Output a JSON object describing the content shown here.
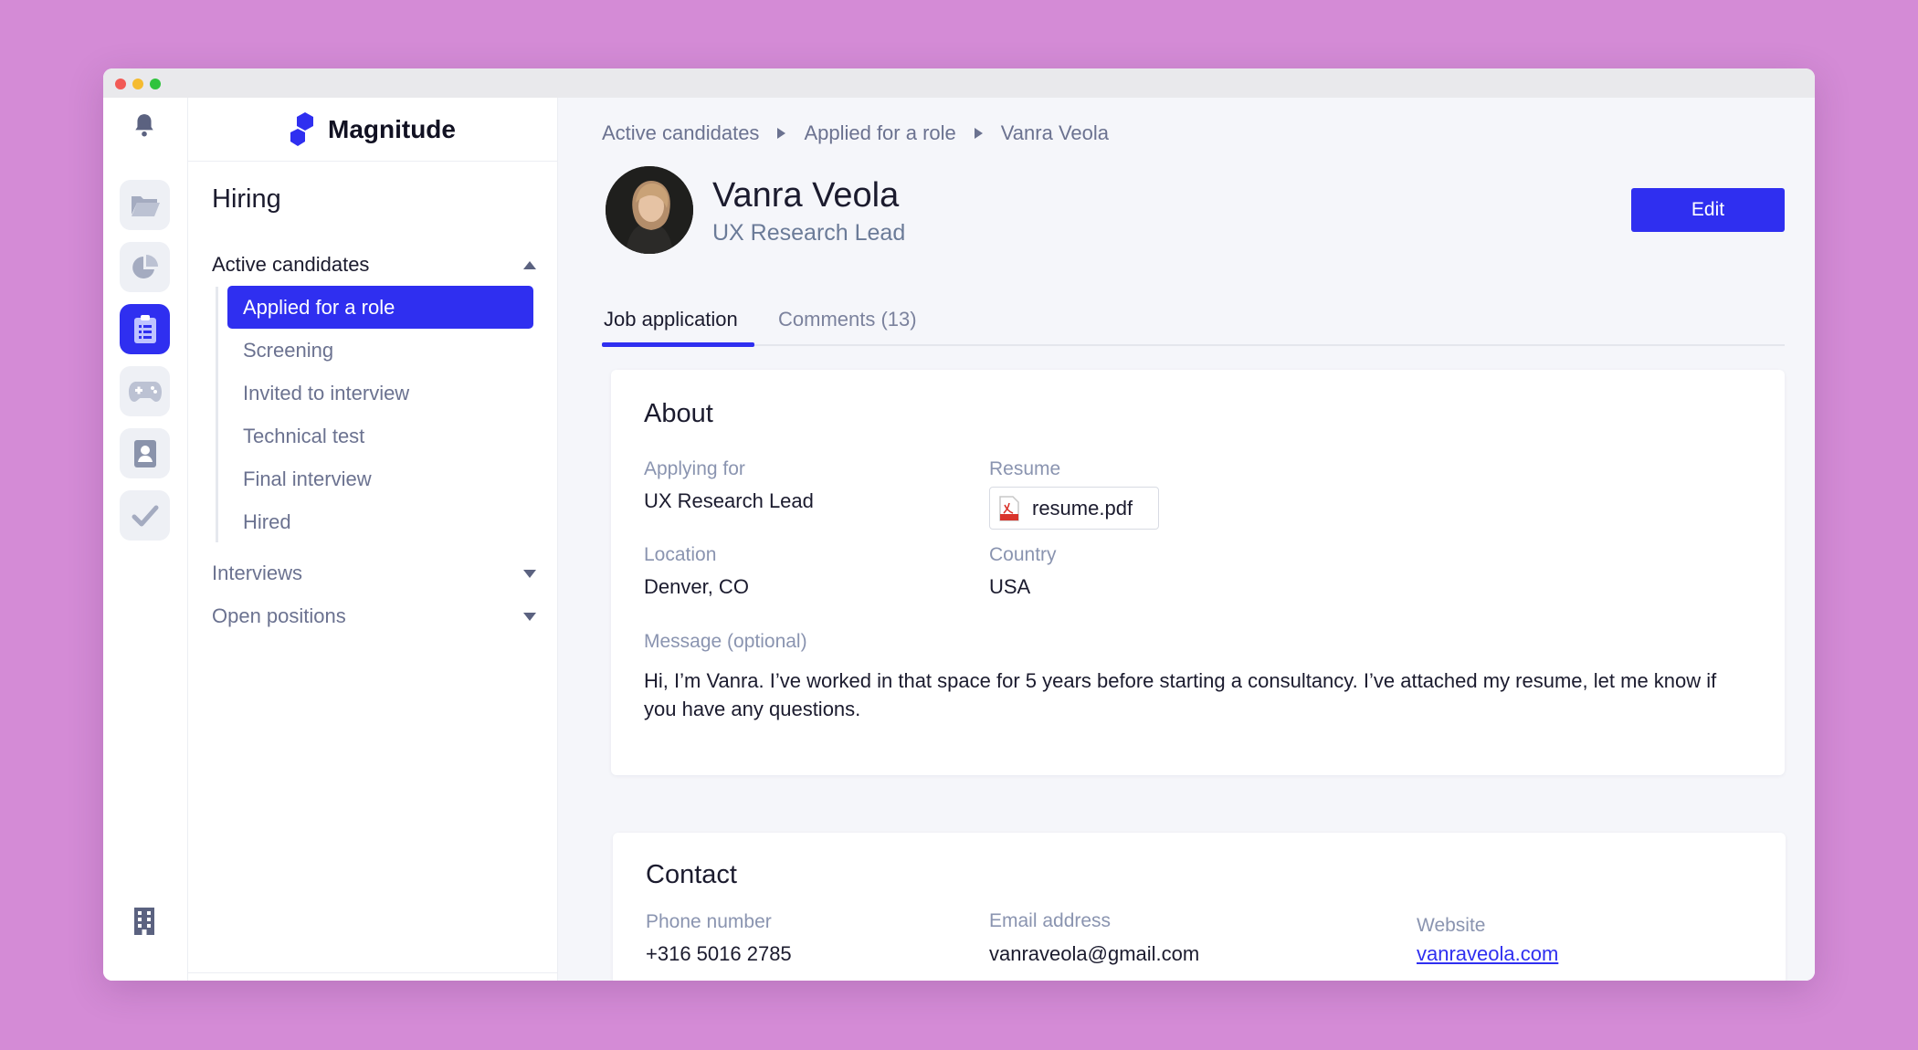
{
  "brand": {
    "name": "Magnitude",
    "color": "#2f2ff0"
  },
  "rail": {
    "icons": [
      "bell-icon",
      "folder-icon",
      "pie-chart-icon",
      "clipboard-icon",
      "gamepad-icon",
      "contact-book-icon",
      "check-icon",
      "building-icon"
    ],
    "active": "clipboard-icon"
  },
  "nav": {
    "title": "Hiring",
    "sections": [
      {
        "label": "Active candidates",
        "expanded": true
      },
      {
        "label": "Interviews",
        "expanded": false
      },
      {
        "label": "Open positions",
        "expanded": false
      }
    ],
    "active_candidates_items": [
      {
        "label": "Applied for a role",
        "active": true
      },
      {
        "label": "Screening",
        "active": false
      },
      {
        "label": "Invited to interview",
        "active": false
      },
      {
        "label": "Technical test",
        "active": false
      },
      {
        "label": "Final interview",
        "active": false
      },
      {
        "label": "Hired",
        "active": false
      }
    ]
  },
  "breadcrumb": [
    "Active candidates",
    "Applied for a role",
    "Vanra Veola"
  ],
  "candidate": {
    "name": "Vanra Veola",
    "role": "UX Research Lead"
  },
  "actions": {
    "edit_label": "Edit"
  },
  "tabs": [
    {
      "label": "Job application",
      "active": true
    },
    {
      "label": "Comments (13)",
      "active": false
    }
  ],
  "about": {
    "title": "About",
    "applying_for_label": "Applying for",
    "applying_for_value": "UX Research Lead",
    "resume_label": "Resume",
    "resume_file": "resume.pdf",
    "location_label": "Location",
    "location_value": "Denver, CO",
    "country_label": "Country",
    "country_value": "USA",
    "message_label": "Message (optional)",
    "message_value": "Hi, I’m Vanra. I’ve worked in that space for 5 years before starting a consultancy. I’ve attached my resume, let me know if you have any questions."
  },
  "contact": {
    "title": "Contact",
    "phone_label": "Phone number",
    "phone_value": "+316 5016 2785",
    "email_label": "Email address",
    "email_value": "vanraveola@gmail.com",
    "website_label": "Website",
    "website_value": "vanraveola.com"
  }
}
